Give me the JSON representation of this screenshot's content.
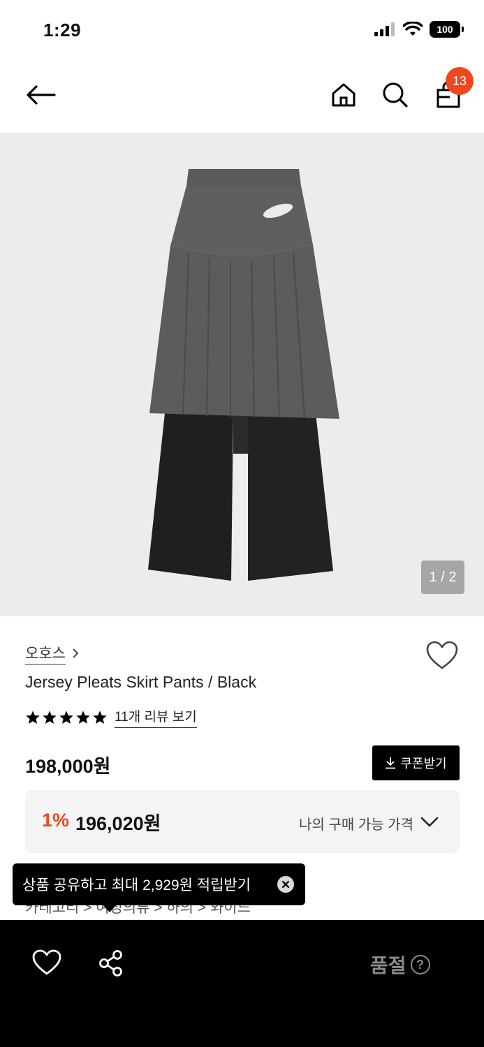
{
  "status_bar": {
    "time": "1:29",
    "battery": "100"
  },
  "header": {
    "cart_count": "13"
  },
  "gallery": {
    "counter": "1 / 2"
  },
  "product": {
    "brand": "오호스",
    "name": "Jersey Pleats Skirt Pants / Black",
    "rating": 5,
    "review_link": "11개 리뷰 보기",
    "price": "198,000원",
    "coupon_button": "쿠폰받기"
  },
  "my_price": {
    "discount_rate": "1%",
    "discount_price": "196,020원",
    "label": "나의 구매 가능 가격"
  },
  "share_toast": {
    "text": "상품 공유하고 최대 2,929원 적립받기"
  },
  "breadcrumb": "카테고리 > 여성의류 > 하의 > 와이드",
  "bottom_bar": {
    "status": "품절",
    "help": "?"
  },
  "colors": {
    "accent": "#f2471c",
    "dark": "#000000",
    "image_bg": "#ececec"
  }
}
